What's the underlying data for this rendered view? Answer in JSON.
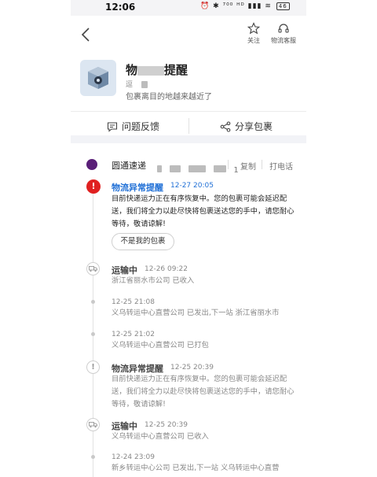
{
  "status_bar": {
    "time": "12:06",
    "indicators": "⏰ ✱ ⁷⁰⁰ ᴴᴰ ▮▮▮ ≋",
    "battery": "46"
  },
  "header": {
    "follow_label": "关注",
    "service_label": "物流客服"
  },
  "package": {
    "title_start": "物",
    "title_end": "提醒",
    "sub_prefix": "逗",
    "hint": "包裹离目的地越来越近了"
  },
  "actions": {
    "feedback": "问题反馈",
    "share": "分享包裹"
  },
  "courier": {
    "name": "圆通速递",
    "tracking_suffix": "1",
    "copy": "复制",
    "call": "打电话"
  },
  "latest": {
    "status": "物流异常提醒",
    "date": "12-27 20:05",
    "text": "目前快递运力正在有序恢复中。您的包裹可能会延迟配送，我们将全力以赴尽快将包裹送达您的手中，请您耐心等待，敬请谅解!",
    "not_mine": "不是我的包裹"
  },
  "events": [
    {
      "title": "运输中",
      "date": "12-26 09:22",
      "text": "浙江省丽水市公司 已收入"
    },
    {
      "time": "12-25 21:08",
      "text": "义乌转运中心直营公司 已发出,下一站 浙江省丽水市"
    },
    {
      "time": "12-25 21:02",
      "text": "义乌转运中心直营公司 已打包"
    },
    {
      "title": "物流异常提醒",
      "date": "12-25 20:39",
      "text": "目前快递运力正在有序恢复中。您的包裹可能会延迟配送，我们将全力以赴尽快将包裹送达您的手中，请您耐心等待，敬请谅解!"
    },
    {
      "title": "运输中",
      "date": "12-25 20:39",
      "text": "义乌转运中心直营公司 已收入"
    },
    {
      "time": "12-24 23:09",
      "text": "新乡转运中心公司 已发出,下一站 义乌转运中心直营"
    }
  ],
  "colors": {
    "accent_blue": "#1f6fd6",
    "alert_red": "#e02020",
    "courier_purple": "#5a1f78"
  }
}
